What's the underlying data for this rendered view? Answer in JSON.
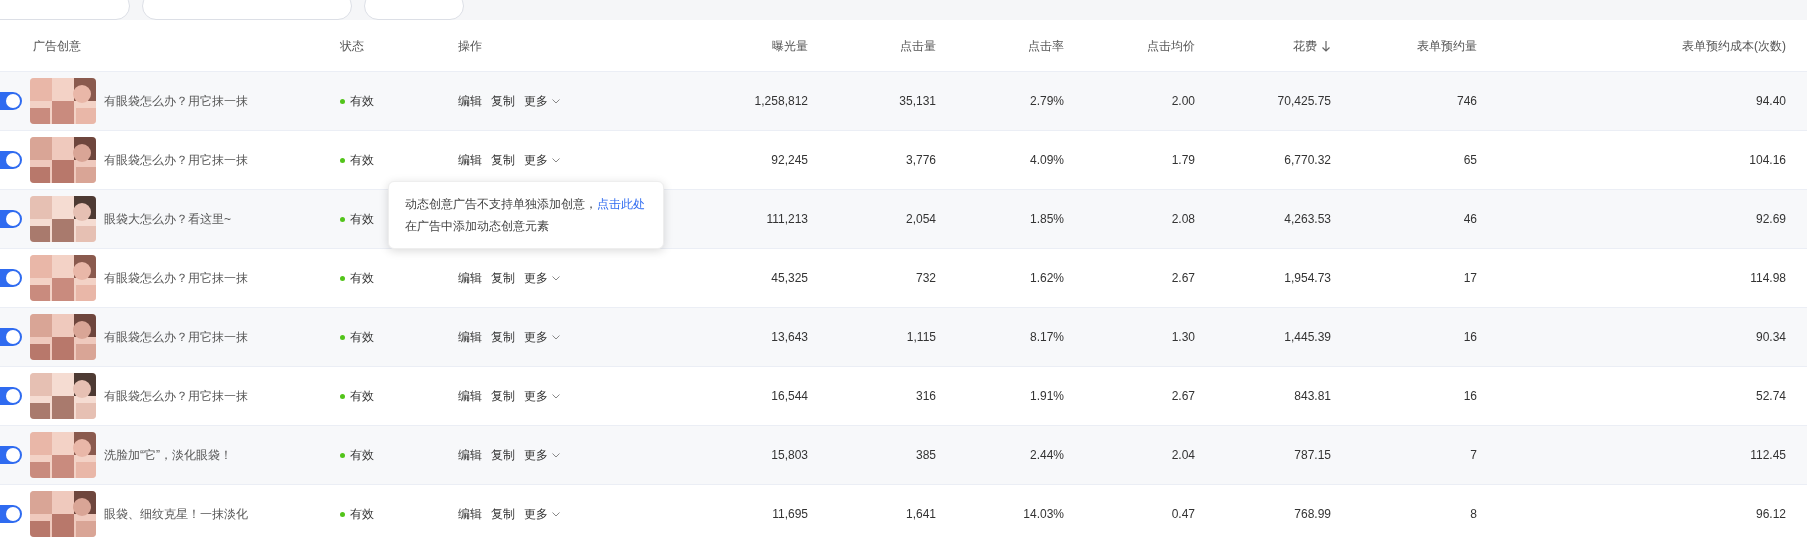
{
  "columns": [
    {
      "label": "广告创意",
      "sorted": false
    },
    {
      "label": "状态",
      "sorted": false
    },
    {
      "label": "操作",
      "sorted": false
    },
    {
      "label": "曝光量",
      "sorted": false
    },
    {
      "label": "点击量",
      "sorted": false
    },
    {
      "label": "点击率",
      "sorted": false
    },
    {
      "label": "点击均价",
      "sorted": false
    },
    {
      "label": "花费",
      "sorted": true
    },
    {
      "label": "表单预约量",
      "sorted": false
    },
    {
      "label": "表单预约成本(次数)",
      "sorted": false
    }
  ],
  "rows": [
    {
      "on": true,
      "thumb": {
        "kind": "picture"
      },
      "title": "有眼袋怎么办？用它抹一抹",
      "status": "有效",
      "actions": [
        "编辑",
        "复制",
        "更多"
      ],
      "values": [
        "1,258,812",
        "35,131",
        "2.79%",
        "2.00",
        "70,425.75",
        "746",
        "94.40"
      ]
    },
    {
      "on": true,
      "thumb": {
        "kind": "picture"
      },
      "title": "有眼袋怎么办？用它抹一抹",
      "status": "有效",
      "actions": [
        "编辑",
        "复制",
        "更多"
      ],
      "values": [
        "92,245",
        "3,776",
        "4.09%",
        "1.79",
        "6,770.32",
        "65",
        "104.16"
      ]
    },
    {
      "on": true,
      "thumb": {
        "kind": "picture"
      },
      "title": "眼袋大怎么办？看这里~",
      "status": "有效",
      "actions": [],
      "values": [
        "111,213",
        "2,054",
        "1.85%",
        "2.08",
        "4,263.53",
        "46",
        "92.69"
      ]
    },
    {
      "on": true,
      "thumb": {
        "kind": "picture"
      },
      "title": "有眼袋怎么办？用它抹一抹",
      "status": "有效",
      "actions": [
        "编辑",
        "复制",
        "更多"
      ],
      "values": [
        "45,325",
        "732",
        "1.62%",
        "2.67",
        "1,954.73",
        "17",
        "114.98"
      ]
    },
    {
      "on": true,
      "thumb": {
        "kind": "picture"
      },
      "title": "有眼袋怎么办？用它抹一抹",
      "status": "有效",
      "actions": [
        "编辑",
        "复制",
        "更多"
      ],
      "values": [
        "13,643",
        "1,115",
        "8.17%",
        "1.30",
        "1,445.39",
        "16",
        "90.34"
      ]
    },
    {
      "on": true,
      "thumb": {
        "kind": "picture"
      },
      "title": "有眼袋怎么办？用它抹一抹",
      "status": "有效",
      "actions": [
        "编辑",
        "复制",
        "更多"
      ],
      "values": [
        "16,544",
        "316",
        "1.91%",
        "2.67",
        "843.81",
        "16",
        "52.74"
      ]
    },
    {
      "on": true,
      "thumb": {
        "kind": "picture"
      },
      "title": "洗脸加“它”，淡化眼袋！",
      "status": "有效",
      "actions": [
        "编辑",
        "复制",
        "更多"
      ],
      "values": [
        "15,803",
        "385",
        "2.44%",
        "2.04",
        "787.15",
        "7",
        "112.45"
      ]
    },
    {
      "on": true,
      "thumb": {
        "kind": "picture"
      },
      "title": "眼袋、细纹克星！一抹淡化",
      "status": "有效",
      "actions": [
        "编辑",
        "复制",
        "更多"
      ],
      "values": [
        "11,695",
        "1,641",
        "14.03%",
        "0.47",
        "768.99",
        "8",
        "96.12"
      ]
    }
  ],
  "tooltip": {
    "text": "动态创意广告不支持单独添加创意，",
    "link": "点击此处",
    "rest": "在广告中添加动态创意元素"
  }
}
